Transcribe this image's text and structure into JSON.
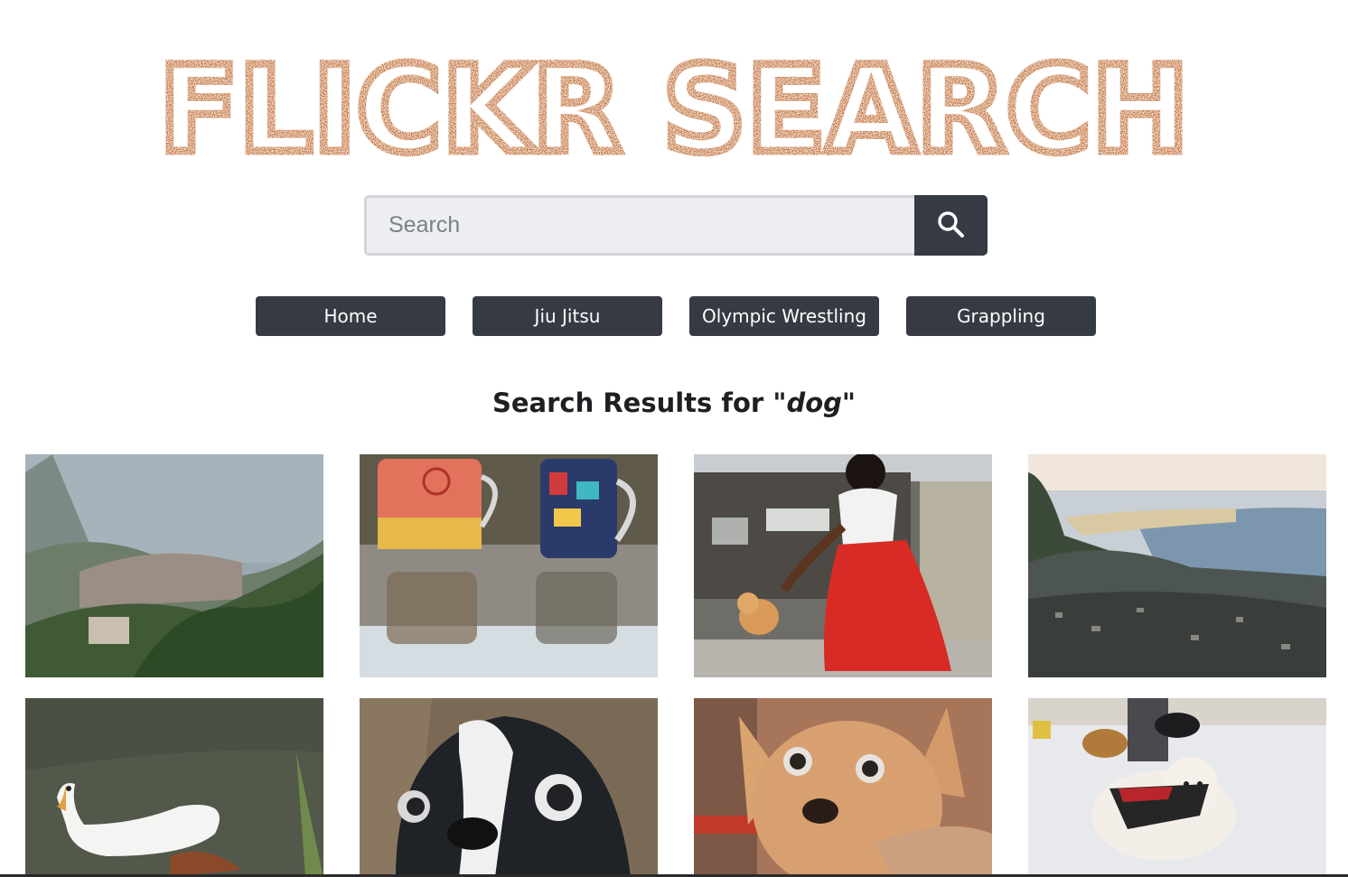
{
  "header": {
    "logo_text": "FLICKR SEARCH",
    "logo_color": "#b85a1b"
  },
  "search": {
    "placeholder": "Search",
    "value": ""
  },
  "nav": {
    "buttons": [
      {
        "label": "Home"
      },
      {
        "label": "Jiu Jitsu"
      },
      {
        "label": "Olympic Wrestling"
      },
      {
        "label": "Grappling"
      }
    ]
  },
  "results": {
    "heading_prefix": "Search Results for \"",
    "query": "dog",
    "heading_suffix": "\""
  },
  "colors": {
    "button_bg": "#363a43",
    "input_bg": "#eceef1",
    "heading": "#1e1f22"
  }
}
